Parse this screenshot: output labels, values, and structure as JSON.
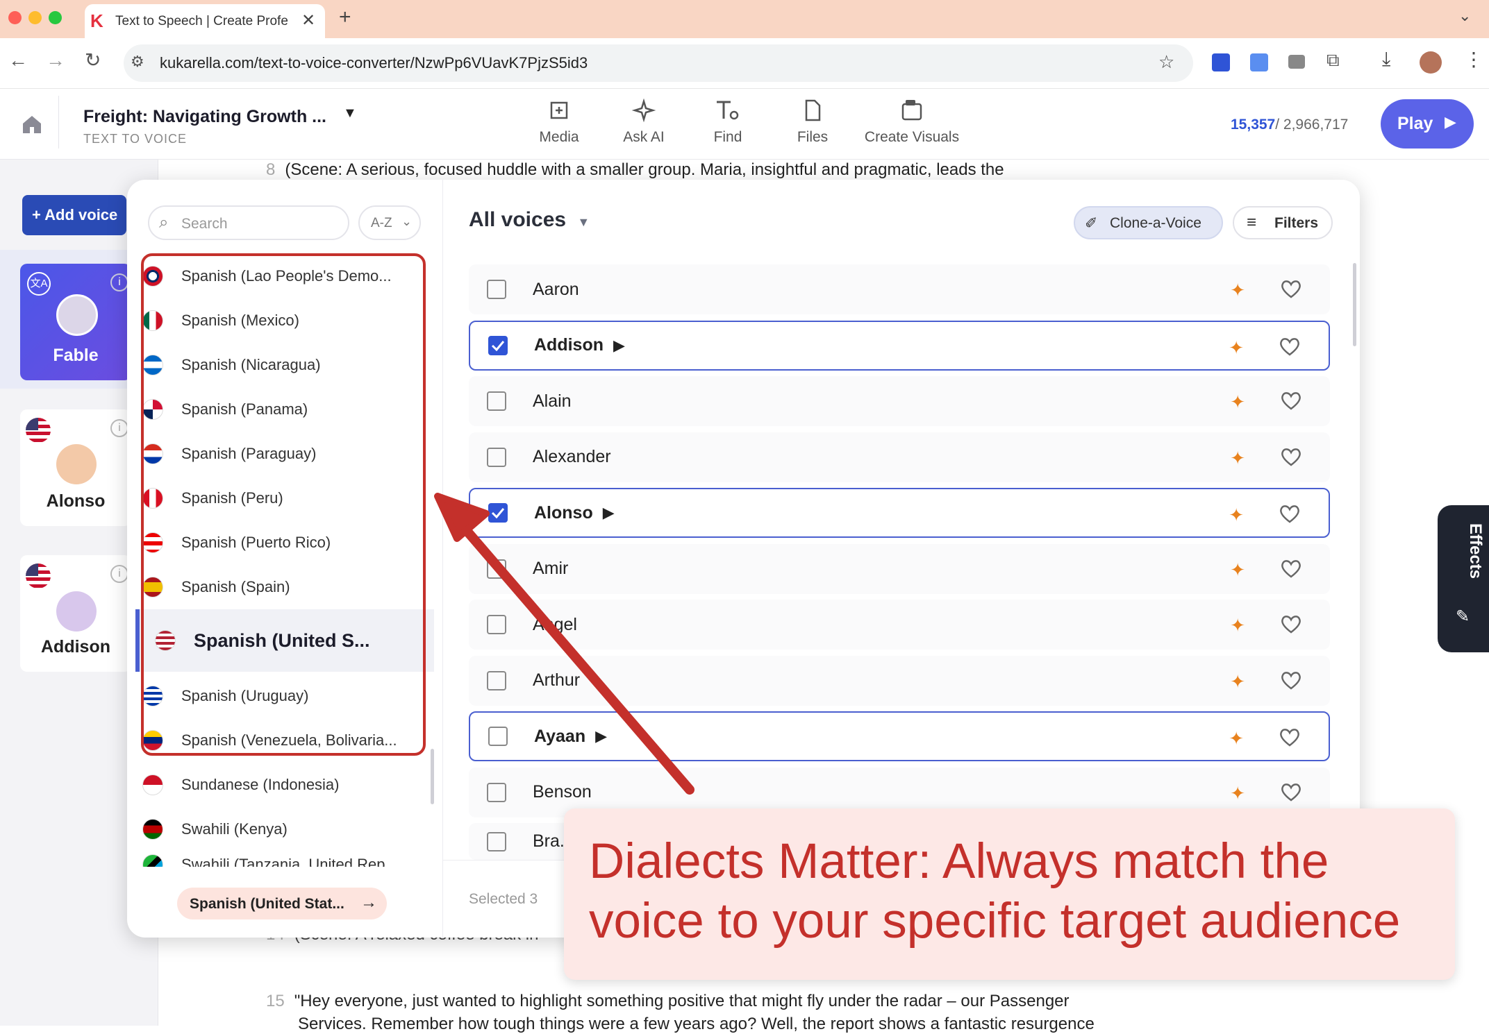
{
  "browser": {
    "tab_title": "Text to Speech | Create Profe",
    "url": "kukarella.com/text-to-voice-converter/NzwPp6VUavK7PjzS5id3"
  },
  "header": {
    "project_title": "Freight: Navigating Growth ...",
    "project_subtitle": "TEXT TO VOICE",
    "tools": [
      "Media",
      "Ask AI",
      "Find",
      "Files",
      "Create Visuals"
    ],
    "credits_used": "15,357",
    "credits_total": "/ 2,966,717",
    "play_label": "Play"
  },
  "editor": {
    "lines": [
      {
        "num": "8",
        "text": "(Scene: A serious, focused huddle with a smaller group. Maria, insightful and pragmatic, leads the"
      },
      {
        "num": "14",
        "text": "(Scene: A relaxed coffee break in"
      },
      {
        "num": "15",
        "text": "\"Hey everyone, just wanted to highlight something positive that might fly under the radar – our Passenger"
      },
      {
        "num": "",
        "text": "Services. Remember how tough things were a few years ago? Well, the report shows a fantastic resurgence"
      }
    ]
  },
  "sidebar": {
    "add_voice_label": "+ Add voice",
    "voices": [
      {
        "name": "Fable",
        "icon": "translate-icon"
      },
      {
        "name": "Alonso",
        "icon": "us-flag-icon"
      },
      {
        "name": "Addison",
        "icon": "us-flag-icon"
      }
    ]
  },
  "panel": {
    "search_placeholder": "Search",
    "sort_label": "A-Z",
    "languages": [
      "Spanish (Lao People's Demo...",
      "Spanish (Mexico)",
      "Spanish (Nicaragua)",
      "Spanish (Panama)",
      "Spanish (Paraguay)",
      "Spanish (Peru)",
      "Spanish (Puerto Rico)",
      "Spanish (Spain)",
      "Spanish (United S...",
      "Spanish (Uruguay)",
      "Spanish (Venezuela, Bolivaria...",
      "Sundanese (Indonesia)",
      "Swahili (Kenya)",
      "Swahili (Tanzania, United Rep..."
    ],
    "selected_language_chip": "Spanish (United Stat...",
    "all_voices_label": "All voices",
    "clone_label": "Clone-a-Voice",
    "filters_label": "Filters",
    "voices": [
      {
        "name": "Aaron",
        "checked": false
      },
      {
        "name": "Addison",
        "checked": true
      },
      {
        "name": "Alain",
        "checked": false
      },
      {
        "name": "Alexander",
        "checked": false
      },
      {
        "name": "Alonso",
        "checked": true
      },
      {
        "name": "Amir",
        "checked": false
      },
      {
        "name": "Angel",
        "checked": false
      },
      {
        "name": "Arthur",
        "checked": false
      },
      {
        "name": "Ayaan",
        "checked": false
      },
      {
        "name": "Benson",
        "checked": false
      },
      {
        "name": "Bra...",
        "checked": false
      }
    ],
    "selected_count_label": "Selected 3"
  },
  "effects_tab_label": "Effects",
  "callout": {
    "text_line1": "Dialects Matter: Always match the",
    "text_line2": "voice to your specific target audience"
  },
  "colors": {
    "accent": "#4a5fd0",
    "annotation_red": "#c4302b",
    "callout_bg": "#fde8e6",
    "titlebar": "#f9d6c4"
  }
}
